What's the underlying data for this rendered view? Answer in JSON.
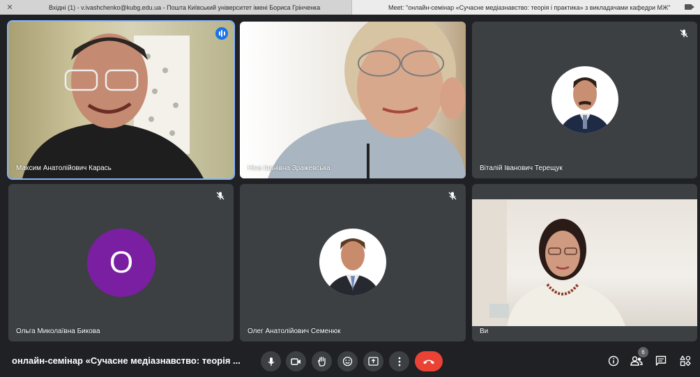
{
  "browser": {
    "tabs": [
      {
        "title": "Вхідні (1) - v.ivashchenko@kubg.edu.ua - Пошта Київський університет імені Бориса Грінченка"
      },
      {
        "title": "Meet: \"онлайн-семінар «Сучасне медіазнавство: теорія і практика» з викладачами кафедри МЖ\""
      }
    ]
  },
  "participants": [
    {
      "name": "Максим Анатолійович Карась",
      "state": "speaking",
      "video": true
    },
    {
      "name": "Ніна Іванівна Зражевська",
      "state": "unmuted",
      "video": true
    },
    {
      "name": "Віталій Іванович Терещук",
      "state": "muted",
      "video": false
    },
    {
      "name": "Ольга Миколаївна Бикова",
      "state": "muted",
      "video": false,
      "initial": "О"
    },
    {
      "name": "Олег Анатолійович Семенюк",
      "state": "muted",
      "video": false
    },
    {
      "name": "Ви",
      "state": "self",
      "video": true
    }
  ],
  "bottom_bar": {
    "meeting_title": "онлайн-семінар «Сучасне медіазнавство: теорія ...",
    "participant_count": "6"
  },
  "colors": {
    "background": "#202124",
    "tile": "#3c4043",
    "accent": "#1a73e8",
    "end_call": "#ea4335",
    "avatar_purple": "#7b1fa2"
  }
}
